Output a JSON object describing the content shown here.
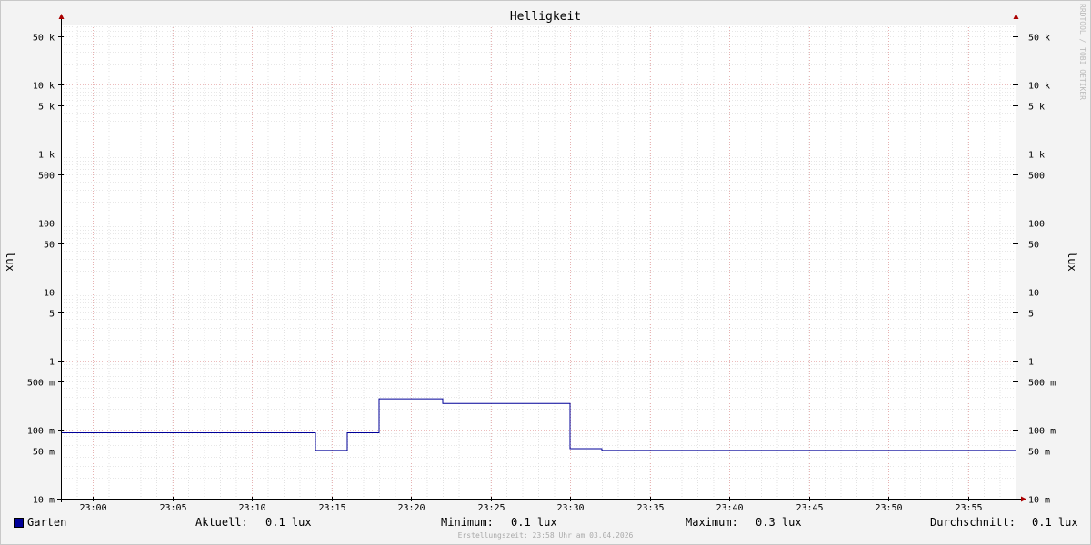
{
  "header": {
    "title": "Helligkeit",
    "watermark": "RRDTOOL / TOBI OETIKER"
  },
  "chart_data": {
    "type": "line",
    "title": "Helligkeit",
    "ylabel": "lux",
    "ylabel_right": "lux",
    "yscale": "log",
    "ylim": [
      0.01,
      75000
    ],
    "xlim": [
      "22:58",
      "23:58"
    ],
    "y_ticks": [
      {
        "value": 0.01,
        "label": "10 m"
      },
      {
        "value": 0.05,
        "label": "50 m"
      },
      {
        "value": 0.1,
        "label": "100 m"
      },
      {
        "value": 0.5,
        "label": "500 m"
      },
      {
        "value": 1,
        "label": "1"
      },
      {
        "value": 5,
        "label": "5"
      },
      {
        "value": 10,
        "label": "10"
      },
      {
        "value": 50,
        "label": "50"
      },
      {
        "value": 100,
        "label": "100"
      },
      {
        "value": 500,
        "label": "500"
      },
      {
        "value": 1000,
        "label": "1 k"
      },
      {
        "value": 5000,
        "label": "5 k"
      },
      {
        "value": 10000,
        "label": "10 k"
      },
      {
        "value": 50000,
        "label": "50 k"
      }
    ],
    "x_ticks": [
      "23:00",
      "23:05",
      "23:10",
      "23:15",
      "23:20",
      "23:25",
      "23:30",
      "23:35",
      "23:40",
      "23:45",
      "23:50",
      "23:55"
    ],
    "grid": true,
    "series": [
      {
        "name": "Garten",
        "color": "#000099",
        "step": true,
        "points": [
          {
            "x": "22:58",
            "y": 0.09
          },
          {
            "x": "23:14",
            "y": 0.05
          },
          {
            "x": "23:16",
            "y": 0.09
          },
          {
            "x": "23:18",
            "y": 0.28
          },
          {
            "x": "23:22",
            "y": 0.24
          },
          {
            "x": "23:30",
            "y": 0.053
          },
          {
            "x": "23:32",
            "y": 0.05
          },
          {
            "x": "23:58",
            "y": 0.05
          }
        ]
      }
    ]
  },
  "legend": {
    "series_name": "Garten",
    "current_label": "Aktuell:",
    "current_value": "0.1 lux",
    "min_label": "Minimum:",
    "min_value": "0.1 lux",
    "max_label": "Maximum:",
    "max_value": "0.3 lux",
    "avg_label": "Durchschnitt:",
    "avg_value": "0.1 lux"
  },
  "footer": {
    "text": "Erstellungszeit: 23:58 Uhr am 03.04.2026"
  },
  "colors": {
    "series": "#000099",
    "major_grid": "#e6a6a6",
    "minor_grid": "#d0d0d0",
    "axis": "#000000",
    "arrow": "#aa0000"
  }
}
